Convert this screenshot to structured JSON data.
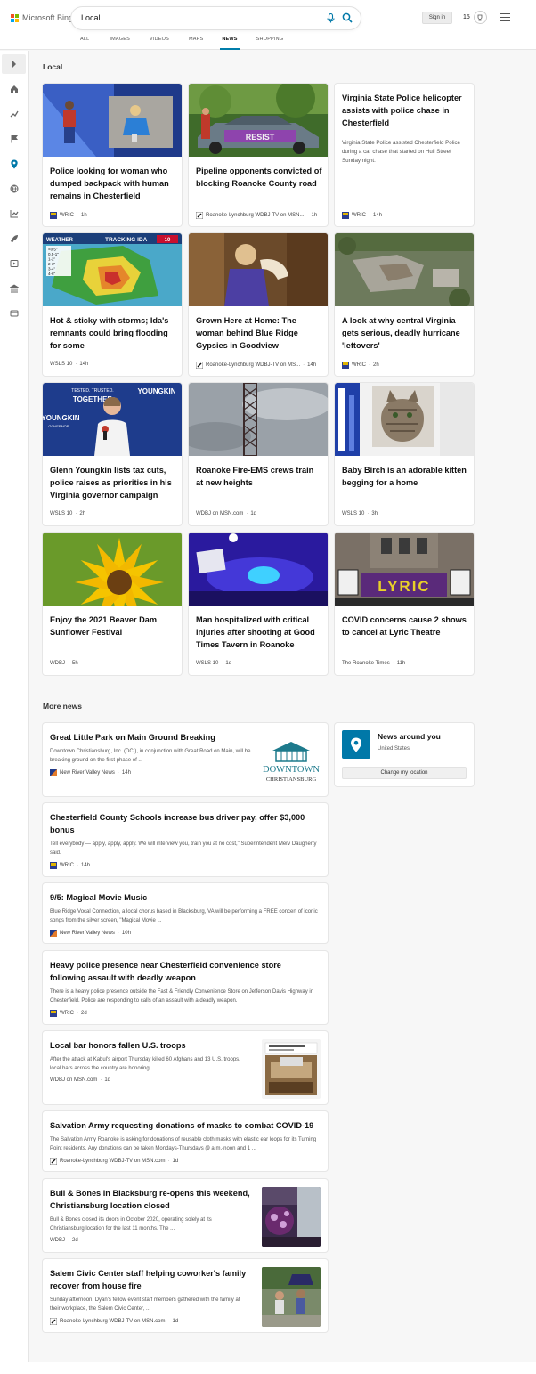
{
  "header": {
    "logo_text": "Microsoft Bing",
    "query": "Local",
    "signin_label": "Sign in",
    "rewards_count": "15",
    "tabs": [
      {
        "label": "ALL",
        "active": false
      },
      {
        "label": "IMAGES",
        "active": false
      },
      {
        "label": "VIDEOS",
        "active": false
      },
      {
        "label": "MAPS",
        "active": false
      },
      {
        "label": "NEWS",
        "active": true
      },
      {
        "label": "SHOPPING",
        "active": false
      }
    ]
  },
  "sidebar": {
    "icons": [
      "expand-icon",
      "home-icon",
      "trending-icon",
      "flag-icon",
      "location-icon",
      "globe-icon",
      "chart-icon",
      "rocket-icon",
      "video-icon",
      "bank-icon",
      "card-icon"
    ]
  },
  "local": {
    "title": "Local",
    "cards": [
      {
        "title": "Police looking for woman who dumped backpack with human remains in Chesterfield",
        "source": "WRIC",
        "time": "1h"
      },
      {
        "title": "Pipeline opponents convicted of blocking Roanoke County road",
        "source": "Roanoke-Lynchburg WDBJ-TV on MSN...",
        "time": "1h"
      },
      {
        "title": "Virginia State Police helicopter assists with police chase in Chesterfield",
        "desc": "Virginia State Police assisted Chesterfield Police during a car chase that started on Hull Street Sunday night.",
        "source": "WRIC",
        "time": "14h"
      },
      {
        "title": "Hot & sticky with storms; Ida's remnants could bring flooding for some",
        "source": "WSLS 10",
        "time": "14h"
      },
      {
        "title": "Grown Here at Home: The woman behind Blue Ridge Gypsies in Goodview",
        "source": "Roanoke-Lynchburg WDBJ-TV on MS...",
        "time": "14h"
      },
      {
        "title": "A look at why central Virginia gets serious, deadly hurricane 'leftovers'",
        "source": "WRIC",
        "time": "2h"
      },
      {
        "title": "Glenn Youngkin lists tax cuts, police raises as priorities in his Virginia governor campaign",
        "source": "WSLS 10",
        "time": "2h"
      },
      {
        "title": "Roanoke Fire-EMS crews train at new heights",
        "source": "WDBJ on MSN.com",
        "time": "1d"
      },
      {
        "title": "Baby Birch is an adorable kitten begging for a home",
        "source": "WSLS 10",
        "time": "3h"
      },
      {
        "title": "Enjoy the 2021 Beaver Dam Sunflower Festival",
        "source": "WDBJ",
        "time": "5h"
      },
      {
        "title": "Man hospitalized with critical injuries after shooting at Good Times Tavern in Roanoke",
        "source": "WSLS 10",
        "time": "1d"
      },
      {
        "title": "COVID concerns cause 2 shows to cancel at Lyric Theatre",
        "source": "The Roanoke Times",
        "time": "11h"
      }
    ],
    "image_text": {
      "weather_banner": "WEATHER",
      "weather_title": "TRACKING IDA",
      "weather_brand": "10",
      "rain_scale": [
        "<0.5\"",
        "0.5-1\"",
        "1-2\"",
        "2-3\"",
        "3-4\"",
        "4-6\""
      ],
      "pipeline_car": "RESIST",
      "youngkin_left": "YOUNGKIN",
      "youngkin_sub": "GOVERNOR",
      "youngkin_right": "YOUNGKIN",
      "youngkin_tag": "TESTED. TRUSTED.",
      "youngkin_back": "TOGETHER",
      "lyric_sign": "LYRIC"
    }
  },
  "more_news": {
    "title": "More news",
    "items": [
      {
        "title": "Great Little Park on Main Ground Breaking",
        "desc": "Downtown Christiansburg, Inc. (DCI), in conjunction with Great Road on Main, will be breaking ground on the first phase of ...",
        "source": "New River Valley News",
        "time": "14h",
        "thumb_text_1": "DOWNTOWN",
        "thumb_text_2": "CHRISTIANSBURG"
      },
      {
        "title": "Chesterfield County Schools increase bus driver pay, offer $3,000 bonus",
        "desc": "Tell everybody — apply, apply, apply. We will interview you, train you at no cost,\" Superintendent Merv Daugherty said.",
        "source": "WRIC",
        "time": "14h"
      },
      {
        "title": "9/5: Magical Movie Music",
        "desc": "Blue Ridge Vocal Connection, a local chorus based in Blacksburg, VA will be performing a FREE concert of iconic songs from the silver screen, \"Magical Movie ...",
        "source": "New River Valley News",
        "time": "10h"
      },
      {
        "title": "Heavy police presence near Chesterfield convenience store following assault with deadly weapon",
        "desc": "There is a heavy police presence outside the Fast & Friendly Convenience Store on Jefferson Davis Highway in Chesterfield. Police are responding to calls of an assault with a deadly weapon.",
        "source": "WRIC",
        "time": "2d"
      },
      {
        "title": "Local bar honors fallen U.S. troops",
        "desc": "After the attack at Kabul's airport Thursday killed 60 Afghans and 13 U.S. troops, local bars across the country are honoring ...",
        "source": "WDBJ on MSN.com",
        "time": "1d"
      },
      {
        "title": "Salvation Army requesting donations of masks to combat COVID-19",
        "desc": "The Salvation Army Roanoke is asking for donations of reusable cloth masks with elastic ear loops for its Turning Point residents. Any donations can be taken Mondays-Thursdays (9 a.m.-noon and 1 ...",
        "source": "Roanoke-Lynchburg WDBJ-TV on MSN.com",
        "time": "1d"
      },
      {
        "title": "Bull & Bones in Blacksburg re-opens this weekend, Christiansburg location closed",
        "desc": "Bull & Bones closed its doors in October 2020, operating solely at its Christiansburg location for the last 11 months. The ...",
        "source": "WDBJ",
        "time": "2d"
      },
      {
        "title": "Salem Civic Center staff helping coworker's family recover from house fire",
        "desc": "Sunday afternoon, Dyan's fellow event staff members gathered with the family at their workplace, the Salem Civic Center, ...",
        "source": "Roanoke-Lynchburg WDBJ-TV on MSN.com",
        "time": "1d"
      }
    ]
  },
  "news_around": {
    "title": "News around you",
    "location": "United States",
    "button_label": "Change my location"
  },
  "colors": {
    "accent": "#007daa",
    "pin_bg": "#0078a8",
    "wric_blue": "#2b3d8f",
    "wsls_red": "#c8102e"
  }
}
